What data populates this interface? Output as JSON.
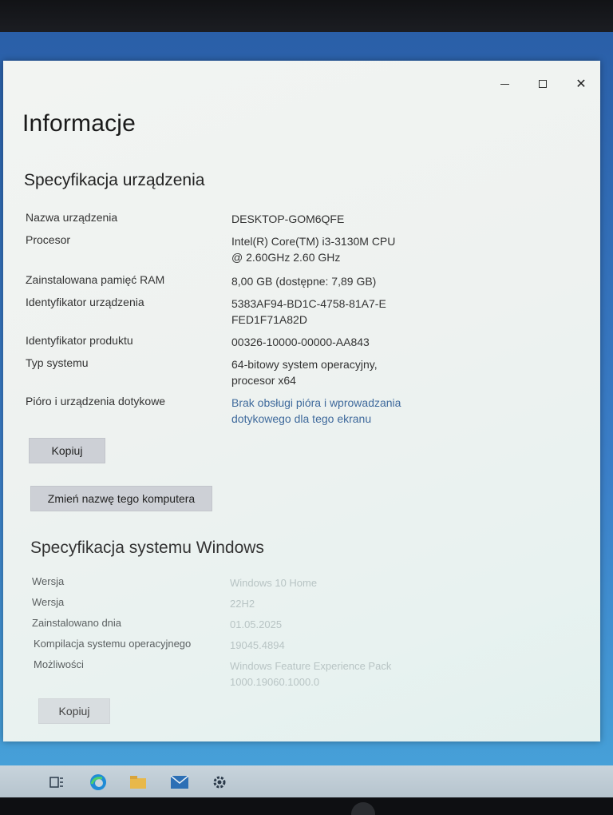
{
  "window": {
    "controls": {
      "minimize": "minimize",
      "maximize": "maximize",
      "close": "✕"
    }
  },
  "page": {
    "title": "Informacje"
  },
  "device_spec": {
    "title": "Specyfikacja urządzenia",
    "rows": [
      {
        "label": "Nazwa urządzenia",
        "value": "DESKTOP-GOM6QFE"
      },
      {
        "label": "Procesor",
        "value": "Intel(R) Core(TM) i3-3130M CPU @ 2.60GHz   2.60 GHz"
      },
      {
        "label": "Zainstalowana pamięć RAM",
        "value": "8,00 GB (dostępne: 7,89 GB)"
      },
      {
        "label": "Identyfikator urządzenia",
        "value": "5383AF94-BD1C-4758-81A7-EFED1F71A82D"
      },
      {
        "label": "Identyfikator produktu",
        "value": "00326-10000-00000-AA843"
      },
      {
        "label": "Typ systemu",
        "value": "64-bitowy system operacyjny, procesor x64"
      },
      {
        "label": "Pióro i urządzenia dotykowe",
        "value": "Brak obsługi pióra i wprowadzania dotykowego dla tego ekranu"
      }
    ],
    "copy_button": "Kopiuj",
    "rename_button": "Zmień nazwę tego komputera"
  },
  "windows_spec": {
    "title": "Specyfikacja systemu Windows",
    "rows": [
      {
        "label": "Wersja",
        "value": "Windows 10 Home"
      },
      {
        "label": "Wersja",
        "value": "22H2"
      },
      {
        "label": "Zainstalowano dnia",
        "value": "01.05.2025"
      },
      {
        "label": "Kompilacja systemu operacyjnego",
        "value": "19045.4894"
      },
      {
        "label": "Możliwości",
        "value": "Windows Feature Experience Pack 1000.19060.1000.0"
      }
    ],
    "copy_button": "Kopiuj"
  },
  "taskbar": {
    "icons": [
      "task-view-icon",
      "edge-icon",
      "explorer-icon",
      "mail-icon",
      "settings-icon"
    ]
  }
}
